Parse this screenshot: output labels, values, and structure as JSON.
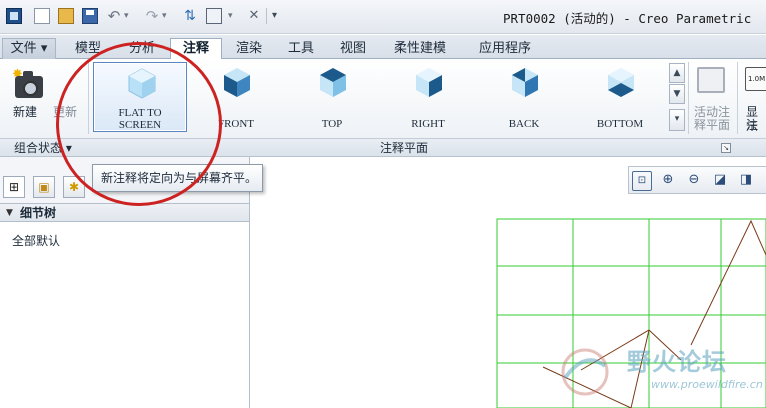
{
  "window": {
    "title": "PRT0002 (活动的) - Creo Parametric"
  },
  "quick_access": {
    "icons": [
      "app-icon",
      "new-icon",
      "open-icon",
      "save-icon",
      "undo-icon",
      "redo-icon",
      "regenerate-icon",
      "windows-icon",
      "close-window-icon",
      "customize-dropdown"
    ]
  },
  "tabs": [
    {
      "label": "文件",
      "suffix": "▾"
    },
    {
      "label": "模型"
    },
    {
      "label": "分析"
    },
    {
      "label": "注释",
      "active": true
    },
    {
      "label": "渲染"
    },
    {
      "label": "工具"
    },
    {
      "label": "视图"
    },
    {
      "label": "柔性建模"
    },
    {
      "label": "应用程序"
    }
  ],
  "ribbon": {
    "new_label": "新建",
    "update_label": "更新",
    "views": [
      {
        "label_line1": "FLAT  TO",
        "label_line2": "SCREEN",
        "selected": true
      },
      {
        "label_line1": "FRONT"
      },
      {
        "label_line1": "TOP"
      },
      {
        "label_line1": "RIGHT"
      },
      {
        "label_line1": "BACK"
      },
      {
        "label_line1": "BOTTOM"
      }
    ],
    "active_note_line1": "活动注",
    "active_note_line2": "释平面",
    "show_note_line1": "显示",
    "show_note_line2": "注释"
  },
  "groups": {
    "combined_state": "组合状态",
    "combined_state_arrow": "▾",
    "annotation_plane": "注释平面"
  },
  "tooltip": {
    "text": "新注释将定向为与屏幕齐平。"
  },
  "left_panel": {
    "detail_tree_title": "细节树",
    "collapse_arrow": "▼",
    "tree_item": "全部默认"
  },
  "watermark": {
    "logo_text": "野火论坛",
    "url": "www.proewildfire.cn"
  },
  "colors": {
    "accent_blue": "#2e6db4",
    "annotation_red": "#cc2222",
    "datum_green": "#33cc33",
    "sketch_brown": "#7a3b1a"
  }
}
